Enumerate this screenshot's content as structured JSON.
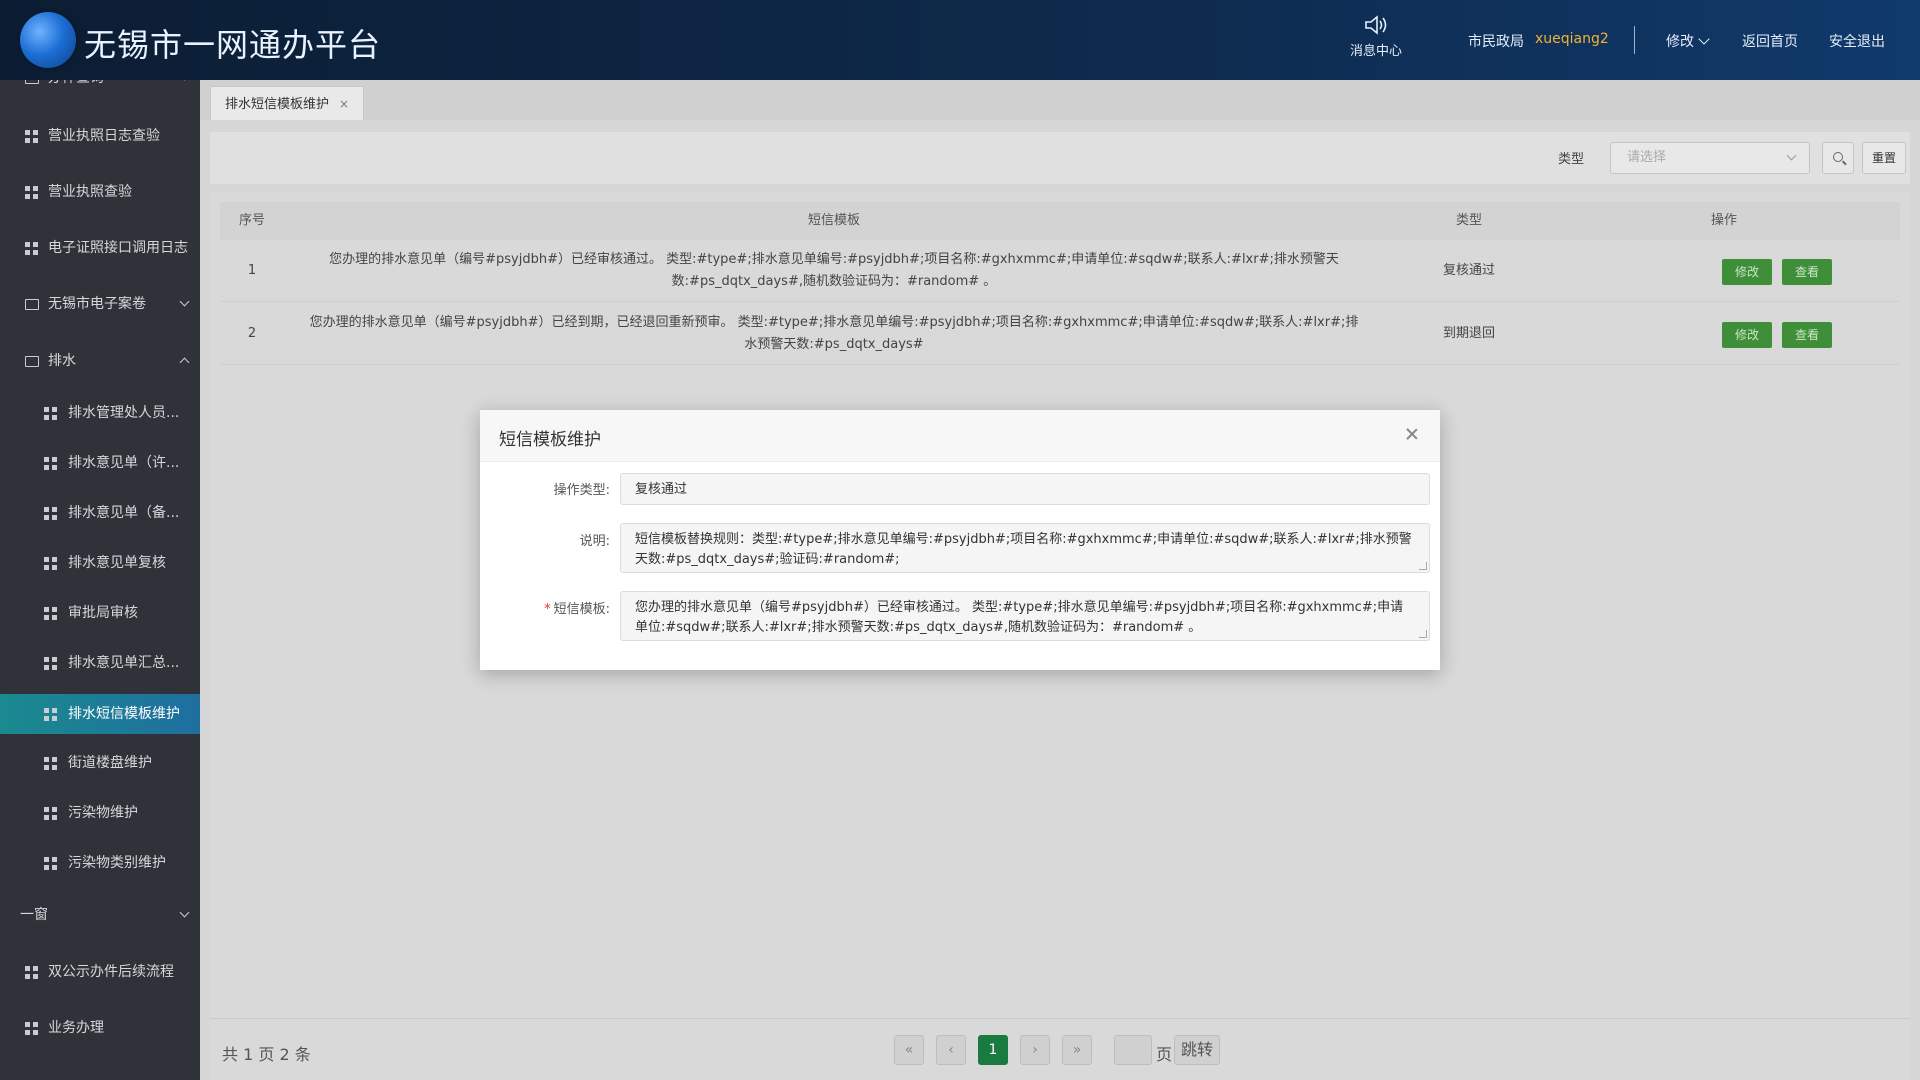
{
  "header": {
    "title": "无锡市一网通办平台",
    "message_center": "消息中心",
    "dept": "市民政局",
    "username": "xueqiang2",
    "modify": "修改",
    "home": "返回首页",
    "logout": "安全退出"
  },
  "sidebar": {
    "items": [
      {
        "label": "办件查询",
        "icon": "folder-icon",
        "indent": false,
        "arrow": "down"
      },
      {
        "label": "营业执照日志查验",
        "icon": "grid-icon",
        "indent": false
      },
      {
        "label": "营业执照查验",
        "icon": "grid-icon",
        "indent": false
      },
      {
        "label": "电子证照接口调用日志",
        "icon": "grid-icon",
        "indent": false
      },
      {
        "label": "无锡市电子案卷",
        "icon": "folder-icon",
        "indent": false,
        "arrow": "down"
      },
      {
        "label": "排水",
        "icon": "folder-icon",
        "indent": false,
        "arrow": "up"
      },
      {
        "label": "排水管理处人员...",
        "icon": "grid-icon",
        "indent": true
      },
      {
        "label": "排水意见单（许...",
        "icon": "grid-icon",
        "indent": true
      },
      {
        "label": "排水意见单（备...",
        "icon": "grid-icon",
        "indent": true
      },
      {
        "label": "排水意见单复核",
        "icon": "grid-icon",
        "indent": true
      },
      {
        "label": "审批局审核",
        "icon": "grid-icon",
        "indent": true
      },
      {
        "label": "排水意见单汇总...",
        "icon": "grid-icon",
        "indent": true
      },
      {
        "label": "排水短信模板维护",
        "icon": "grid-icon",
        "indent": true,
        "active": true
      },
      {
        "label": "街道楼盘维护",
        "icon": "grid-icon",
        "indent": true
      },
      {
        "label": "污染物维护",
        "icon": "grid-icon",
        "indent": true
      },
      {
        "label": "污染物类别维护",
        "icon": "grid-icon",
        "indent": true
      },
      {
        "label": "一窗",
        "icon": "none",
        "indent": false,
        "arrow": "down"
      },
      {
        "label": "双公示办件后续流程",
        "icon": "grid-icon",
        "indent": false
      },
      {
        "label": "业务办理",
        "icon": "grid-icon",
        "indent": false
      }
    ]
  },
  "tabs": [
    {
      "label": "排水短信模板维护",
      "close": "×"
    }
  ],
  "filter": {
    "type_label": "类型",
    "type_placeholder": "请选择",
    "reset_label": "重置"
  },
  "table": {
    "columns": [
      "序号",
      "短信模板",
      "类型",
      "操作"
    ],
    "rows": [
      {
        "index": "1",
        "template": "您办理的排水意见单（编号#psyjdbh#）已经审核通过。 类型:#type#;排水意见单编号:#psyjdbh#;项目名称:#gxhxmmc#;申请单位:#sqdw#;联系人:#lxr#;排水预警天数:#ps_dqtx_days#,随机数验证码为：#random# 。",
        "type": "复核通过",
        "edit": "修改",
        "view": "查看"
      },
      {
        "index": "2",
        "template": "您办理的排水意见单（编号#psyjdbh#）已经到期，已经退回重新预审。 类型:#type#;排水意见单编号:#psyjdbh#;项目名称:#gxhxmmc#;申请单位:#sqdw#;联系人:#lxr#;排水预警天数:#ps_dqtx_days#",
        "type": "到期退回",
        "edit": "修改",
        "view": "查看"
      }
    ]
  },
  "pagination": {
    "total": "共 1 页 2 条",
    "first": "«",
    "prev": "‹",
    "current": "1",
    "next": "›",
    "last": "»",
    "page_unit": "页",
    "jump": "跳转"
  },
  "dialog": {
    "title": "短信模板维护",
    "op_type_label": "操作类型:",
    "op_type_value": "复核通过",
    "desc_label": "说明:",
    "desc_value": "短信模板替换规则：类型:#type#;排水意见单编号:#psyjdbh#;项目名称:#gxhxmmc#;申请单位:#sqdw#;联系人:#lxr#;排水预警天数:#ps_dqtx_days#;验证码:#random#;",
    "tpl_required": "*",
    "tpl_label": "短信模板:",
    "tpl_value": "您办理的排水意见单（编号#psyjdbh#）已经审核通过。 类型:#type#;排水意见单编号:#psyjdbh#;项目名称:#gxhxmmc#;申请单位:#sqdw#;联系人:#lxr#;排水预警天数:#ps_dqtx_days#,随机数验证码为：#random# 。"
  },
  "colors": {
    "header_bg": "#0e2a4d",
    "sidebar_bg": "#2f3339",
    "active_item": "#1a8a8f",
    "username": "#f2b233",
    "action_green": "#3f8f3a",
    "page_current": "#1a7a3f"
  }
}
